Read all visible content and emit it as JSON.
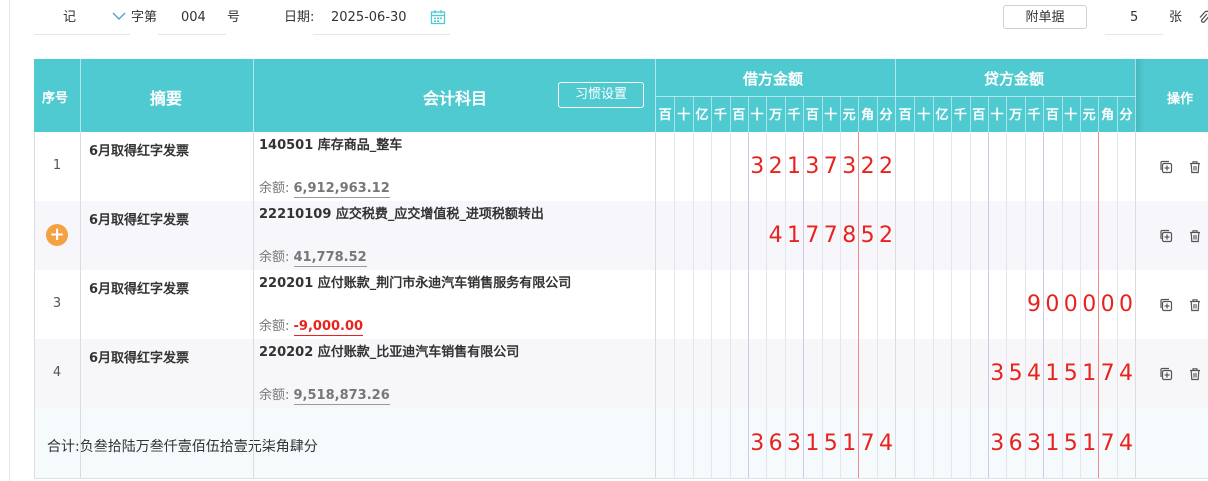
{
  "topbar": {
    "voucher_type": "记",
    "word_label": "字第",
    "voucher_no": "004",
    "no_suffix": "号",
    "date_label": "日期:",
    "date_value": "2025-06-30",
    "attach_button": "附单据",
    "attach_count": "5",
    "attach_unit": "张"
  },
  "table": {
    "headers": {
      "seq": "序号",
      "summary": "摘要",
      "account": "会计科目",
      "habit_button": "习惯设置",
      "debit": "借方金额",
      "credit": "贷方金额",
      "ops": "操作"
    },
    "units": [
      "百",
      "十",
      "亿",
      "千",
      "百",
      "十",
      "万",
      "千",
      "百",
      "十",
      "元",
      "角",
      "分"
    ],
    "balance_label": "余额:",
    "rows": [
      {
        "seq": "1",
        "summary": "6月取得红字发票",
        "account": "140501 库存商品_整车",
        "balance": "6,912,963.12",
        "debit": "32137322",
        "credit": ""
      },
      {
        "seq": "",
        "summary": "6月取得红字发票",
        "account": "22210109 应交税费_应交增值税_进项税额转出",
        "balance": "41,778.52",
        "debit": "4177852",
        "credit": ""
      },
      {
        "seq": "3",
        "summary": "6月取得红字发票",
        "account": "220201 应付账款_荆门市永迪汽车销售服务有限公司",
        "balance": "-9,000.00",
        "debit": "",
        "credit": "900000"
      },
      {
        "seq": "4",
        "summary": "6月取得红字发票",
        "account": "220202 应付账款_比亚迪汽车销售有限公司",
        "balance": "9,518,873.26",
        "debit": "",
        "credit": "35415174"
      }
    ],
    "total": {
      "label": "合计:负叁拾陆万叁仟壹佰伍拾壹元柒角肆分",
      "debit": "36315174",
      "credit": "36315174"
    }
  },
  "colors": {
    "header_bg": "#4fcad0",
    "amount_red": "#e8231d",
    "add_orange": "#f5a143"
  }
}
